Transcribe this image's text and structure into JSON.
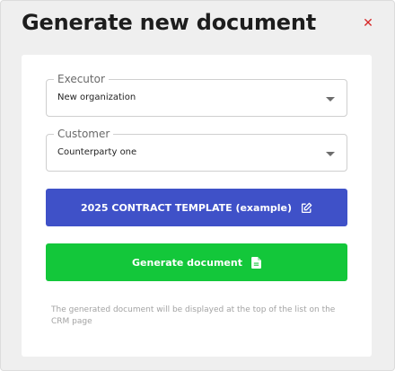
{
  "modal": {
    "title": "Generate new document",
    "close_icon": "close-icon",
    "close_glyph": "✕",
    "accent_color": "#d62828"
  },
  "form": {
    "executor": {
      "label": "Executor",
      "value": "New organization"
    },
    "customer": {
      "label": "Customer",
      "value": "Counterparty one"
    }
  },
  "buttons": {
    "template": {
      "label": "2025 CONTRACT TEMPLATE (example)",
      "icon": "edit-icon",
      "color": "#3f51c8"
    },
    "generate": {
      "label": "Generate document",
      "icon": "document-icon",
      "color": "#13c73a"
    }
  },
  "note": "The generated document will be displayed at the top of the list on the CRM page"
}
